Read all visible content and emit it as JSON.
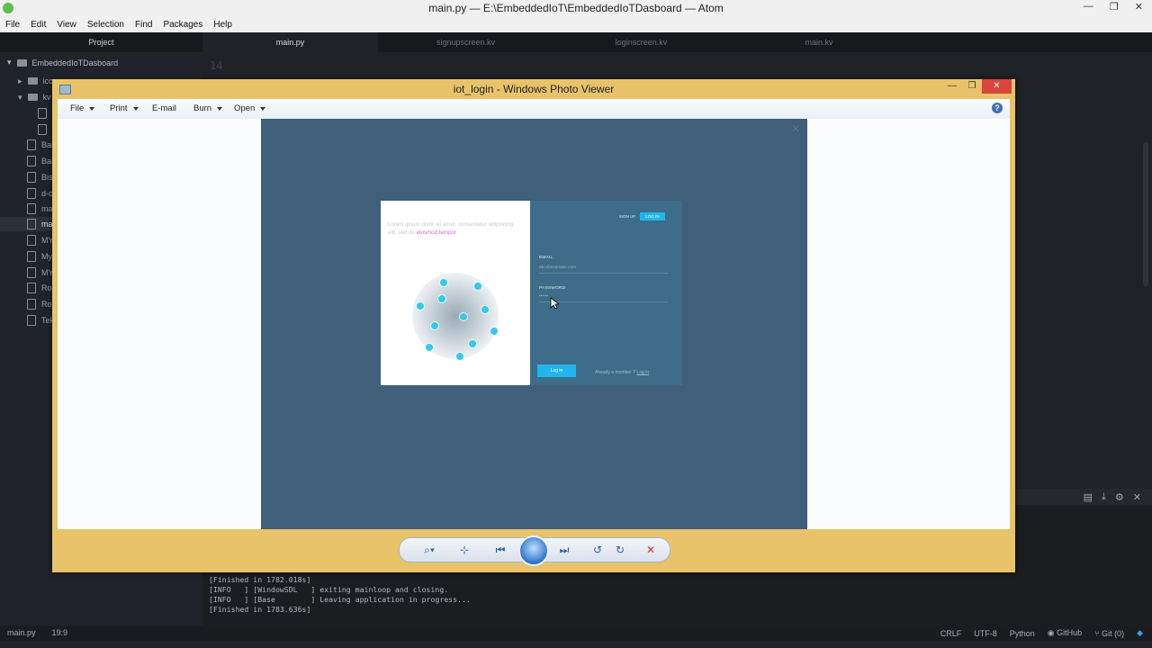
{
  "atom": {
    "title": "main.py — E:\\EmbeddedIoT\\EmbeddedIoTDasboard — Atom",
    "window_controls": [
      "—",
      "❐",
      "✕"
    ],
    "menu": [
      "File",
      "Edit",
      "View",
      "Selection",
      "Find",
      "Packages",
      "Help"
    ],
    "project_tab": "Project",
    "tabs": [
      "main.py",
      "signupscreen.kv",
      "loginscreen.kv",
      "main.kv"
    ],
    "tree_root": "EmbeddedIoTDasboard",
    "tree_items": [
      "ico",
      "kv",
      "",
      "",
      "Bar",
      "Bar",
      "Bis",
      "d-c",
      "ma",
      "ma",
      "MY",
      "My",
      "MY",
      "Rol",
      "Rol",
      "Tek"
    ],
    "line_number": "14",
    "console_lines": [
      "[Finished in 1782.018s]",
      "[INFO   ] [WindowSDL   ] exiting mainloop and closing.",
      "[INFO   ] [Base        ] Leaving application in progress...",
      "[Finished in 1783.636s]"
    ],
    "status_left": [
      "main.py",
      "19:9"
    ],
    "status_right": [
      "CRLF",
      "UTF-8",
      "Python",
      "GitHub",
      "Git (0)"
    ],
    "panel_icons": [
      "▤",
      "⤓",
      "⚙",
      "✕"
    ]
  },
  "viewer": {
    "title": "iot_login - Windows Photo Viewer",
    "toolbar": [
      {
        "label": "File",
        "dropdown": true
      },
      {
        "label": "Print",
        "dropdown": true
      },
      {
        "label": "E-mail",
        "dropdown": false
      },
      {
        "label": "Burn",
        "dropdown": true
      },
      {
        "label": "Open",
        "dropdown": true
      }
    ],
    "help": "?",
    "controls": {
      "minimize": "—",
      "maximize": "❐",
      "close": "✕"
    },
    "bottom_icons": {
      "zoom": "⌕▾",
      "fit": "⊹",
      "prev": "⏮",
      "next": "⏭",
      "rotate_ccw": "↺",
      "rotate_cw": "↻",
      "delete": "✕"
    }
  },
  "photo": {
    "close": "✕",
    "lorem_prefix": "Lorem ipsum dolor sit amet, consectetur adipiscing elit, sed do ",
    "lorem_accent": "eiusmod tempor",
    "signup_button": "SIGN UP",
    "login_button": "LOG IN",
    "email_label": "EMAIL",
    "email_value": "abc@example.com",
    "password_label": "PASSWORD",
    "password_value": "••••••",
    "submit_label": "Log in",
    "already_text": "Already a member ?",
    "already_link": "Log in"
  },
  "colors": {
    "viewer_frame": "#e8c36a",
    "photo_bg": "#3f5f7b",
    "accent": "#1fb6ef",
    "close_red": "#d9453a"
  }
}
